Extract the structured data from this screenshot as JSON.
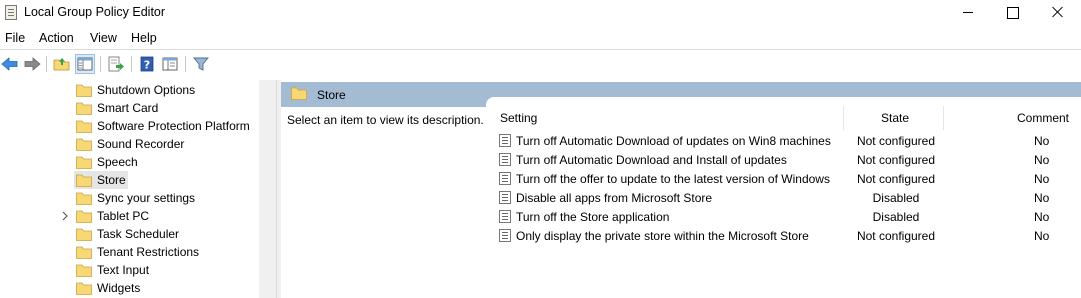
{
  "window": {
    "title": "Local Group Policy Editor"
  },
  "menu": [
    "File",
    "Action",
    "View",
    "Help"
  ],
  "toolbar": {
    "icons": [
      "back-arrow-icon",
      "forward-arrow-icon",
      "up-folder-icon",
      "show-hide-tree-icon",
      "export-list-icon",
      "help-icon",
      "extended-view-icon",
      "filter-icon"
    ]
  },
  "tree": {
    "items": [
      {
        "label": "Shutdown Options"
      },
      {
        "label": "Smart Card"
      },
      {
        "label": "Software Protection Platform"
      },
      {
        "label": "Sound Recorder"
      },
      {
        "label": "Speech"
      },
      {
        "label": "Store"
      },
      {
        "label": "Sync your settings"
      },
      {
        "label": "Tablet PC"
      },
      {
        "label": "Task Scheduler"
      },
      {
        "label": "Tenant Restrictions"
      },
      {
        "label": "Text Input"
      },
      {
        "label": "Widgets"
      }
    ],
    "selected": "Store"
  },
  "right": {
    "header": "Store",
    "description": "Select an item to view its description.",
    "columns": {
      "setting": "Setting",
      "state": "State",
      "comment": "Comment"
    },
    "rows": [
      {
        "setting": "Turn off Automatic Download of updates on Win8 machines",
        "state": "Not configured",
        "comment": "No"
      },
      {
        "setting": "Turn off Automatic Download and Install of updates",
        "state": "Not configured",
        "comment": "No"
      },
      {
        "setting": "Turn off the offer to update to the latest version of Windows",
        "state": "Not configured",
        "comment": "No"
      },
      {
        "setting": "Disable all apps from Microsoft Store",
        "state": "Disabled",
        "comment": "No"
      },
      {
        "setting": "Turn off the Store application",
        "state": "Disabled",
        "comment": "No"
      },
      {
        "setting": "Only display the private store within the Microsoft Store",
        "state": "Not configured",
        "comment": "No"
      }
    ]
  },
  "colors": {
    "header_bg": "#a3bcd4",
    "folder_yellow": "#f8d775",
    "selection_bg": "#e5e5e5",
    "arrow_blue": "#3a8de0"
  }
}
